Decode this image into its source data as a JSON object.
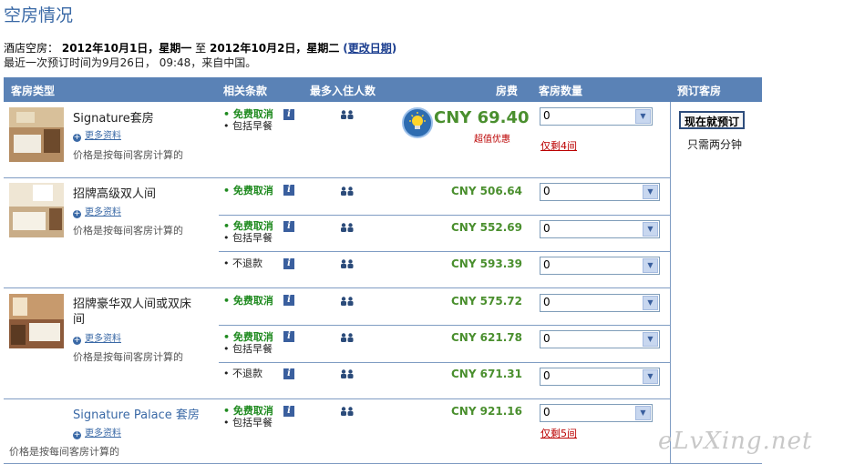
{
  "page_title": "空房情况",
  "stay": {
    "label": "酒店空房：",
    "from": "2012年10月1日，星期一",
    "to_word": "至",
    "to": "2012年10月2日，星期二",
    "change_link_open": "(",
    "change_link": "更改日期",
    "change_link_close": ")"
  },
  "last_booked": "最近一次预订时间为9月26日， 09:48，来自中国。",
  "headers": {
    "room_type": "客房类型",
    "terms": "相关条款",
    "max_occupancy": "最多入住人数",
    "rate": "房费",
    "rooms": "客房数量",
    "book": "预订客房"
  },
  "common": {
    "more_info": "更多资料",
    "price_note": "价格是按每间客房计算的",
    "free_cancel": "• 免费取消",
    "breakfast": "• 包括早餐",
    "non_refundable": "• 不退款",
    "info_glyph": "i",
    "select_value": "0"
  },
  "rooms": [
    {
      "name": "Signature套房",
      "rates": [
        {
          "terms": [
            "free",
            "breakfast"
          ],
          "price": "CNY 69.40",
          "deal": "超值优惠",
          "remaining": "仅剩4间"
        }
      ]
    },
    {
      "name": "招牌高级双人间",
      "rates": [
        {
          "terms": [
            "free"
          ],
          "price": "CNY 506.64"
        },
        {
          "terms": [
            "free",
            "breakfast"
          ],
          "price": "CNY 552.69"
        },
        {
          "terms": [
            "nonref"
          ],
          "price": "CNY 593.39"
        }
      ]
    },
    {
      "name_line1": "招牌豪华双人间或双床",
      "name_line2": "间",
      "rates": [
        {
          "terms": [
            "free"
          ],
          "price": "CNY 575.72"
        },
        {
          "terms": [
            "free",
            "breakfast"
          ],
          "price": "CNY 621.78"
        },
        {
          "terms": [
            "nonref"
          ],
          "price": "CNY 671.31"
        }
      ]
    },
    {
      "name": "Signature Palace 套房",
      "rates": [
        {
          "terms": [
            "free",
            "breakfast"
          ],
          "price": "CNY 921.16",
          "remaining": "仅剩5间"
        }
      ]
    }
  ],
  "book_button": "现在就预订",
  "book_note": "只需两分钟",
  "watermark": "eLvXing.net",
  "colors": {
    "header_bg": "#5a82b6",
    "price_green": "#4a8f2e",
    "free_green": "#1f8a1f",
    "alert_red": "#bb0000",
    "link_blue": "#3a69a6"
  }
}
